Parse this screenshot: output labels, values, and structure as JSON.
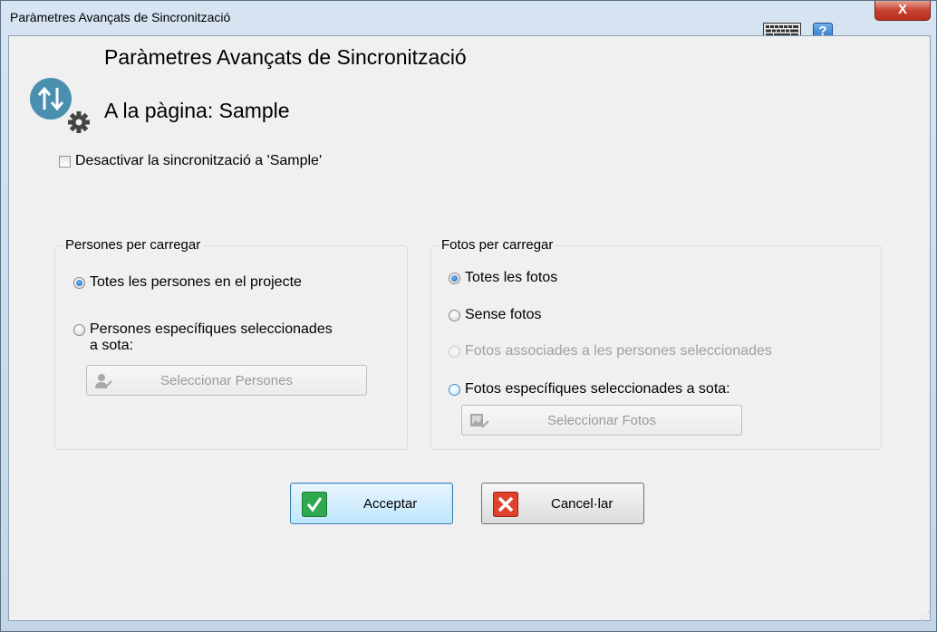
{
  "window": {
    "title": "Paràmetres Avançats de Sincronització",
    "help_label": "?",
    "close_label": "X"
  },
  "header": {
    "title": "Paràmetres Avançats de Sincronització",
    "subtitle": "A la pàgina: Sample",
    "icon": "sync-settings-icon"
  },
  "disable_sync": {
    "label": "Desactivar la sincronització a 'Sample'",
    "checked": false
  },
  "persons_group": {
    "legend": "Persones per carregar",
    "options": [
      {
        "label": "Totes les persones en el projecte",
        "checked": true
      },
      {
        "label_line1": "Persones específiques seleccionades",
        "label_line2": "a sota:",
        "checked": false
      }
    ],
    "select_button": "Seleccionar Persones"
  },
  "photos_group": {
    "legend": "Fotos per carregar",
    "options": [
      {
        "label": "Totes les fotos",
        "checked": true
      },
      {
        "label": "Sense fotos",
        "checked": false
      },
      {
        "label": "Fotos associades a les persones seleccionades",
        "checked": false,
        "disabled": true
      },
      {
        "label": "Fotos específiques seleccionades a sota:",
        "checked": false
      }
    ],
    "select_button": "Seleccionar Fotos"
  },
  "buttons": {
    "accept": "Acceptar",
    "cancel": "Cancel·lar"
  },
  "colors": {
    "accent_blue": "#1b63b8",
    "accept_green": "#2fa84f",
    "cancel_red": "#e0412d",
    "icon_teal": "#4a8fb0"
  }
}
